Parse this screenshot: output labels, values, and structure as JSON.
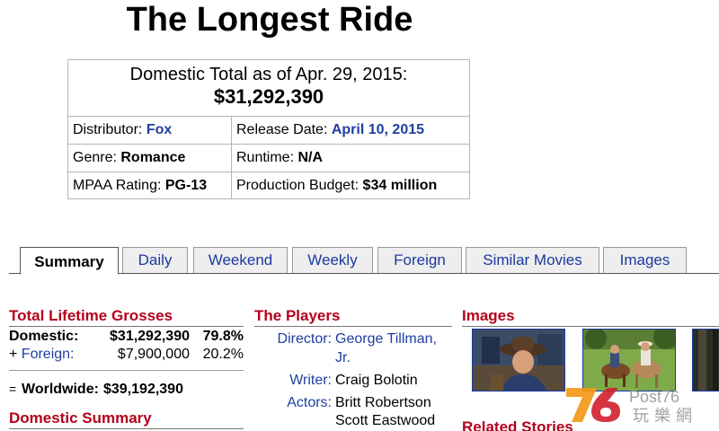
{
  "movie": {
    "title": "The Longest Ride"
  },
  "infobox": {
    "domestic_caption": "Domestic Total as of Apr. 29, 2015:",
    "domestic_total": "$31,292,390",
    "distributor_label": "Distributor:",
    "distributor": "Fox",
    "release_label": "Release Date:",
    "release_date": "April 10, 2015",
    "genre_label": "Genre:",
    "genre": "Romance",
    "runtime_label": "Runtime:",
    "runtime": "N/A",
    "mpaa_label": "MPAA Rating:",
    "mpaa": "PG-13",
    "budget_label": "Production Budget:",
    "budget": "$34 million"
  },
  "tabs": [
    {
      "label": "Summary",
      "active": true
    },
    {
      "label": "Daily"
    },
    {
      "label": "Weekend"
    },
    {
      "label": "Weekly"
    },
    {
      "label": "Foreign"
    },
    {
      "label": "Similar Movies"
    },
    {
      "label": "Images"
    }
  ],
  "grosses": {
    "heading": "Total Lifetime Grosses",
    "domestic_label": "Domestic:",
    "domestic_value": "$31,292,390",
    "domestic_pct": "79.8%",
    "foreign_prefix": "+",
    "foreign_label": "Foreign:",
    "foreign_value": "$7,900,000",
    "foreign_pct": "20.2%",
    "worldwide_prefix": "=",
    "worldwide_label": "Worldwide:",
    "worldwide_value": "$39,192,390"
  },
  "domestic_summary": {
    "heading": "Domestic Summary"
  },
  "players": {
    "heading": "The Players",
    "director_label": "Director:",
    "director_line1": "George Tillman,",
    "director_line2": "Jr.",
    "writer_label": "Writer:",
    "writer": "Craig Bolotin",
    "actors_label": "Actors:",
    "actors": [
      "Britt Robertson",
      "Scott Eastwood"
    ]
  },
  "images": {
    "heading": "Images"
  },
  "related": {
    "heading": "Related Stories"
  },
  "watermark": {
    "number": "76",
    "brand": "Post76",
    "cn": "玩樂網"
  },
  "colors": {
    "link": "#1f3fa0",
    "section_heading": "#b3001b",
    "tab_bg": "#eeeeee"
  }
}
